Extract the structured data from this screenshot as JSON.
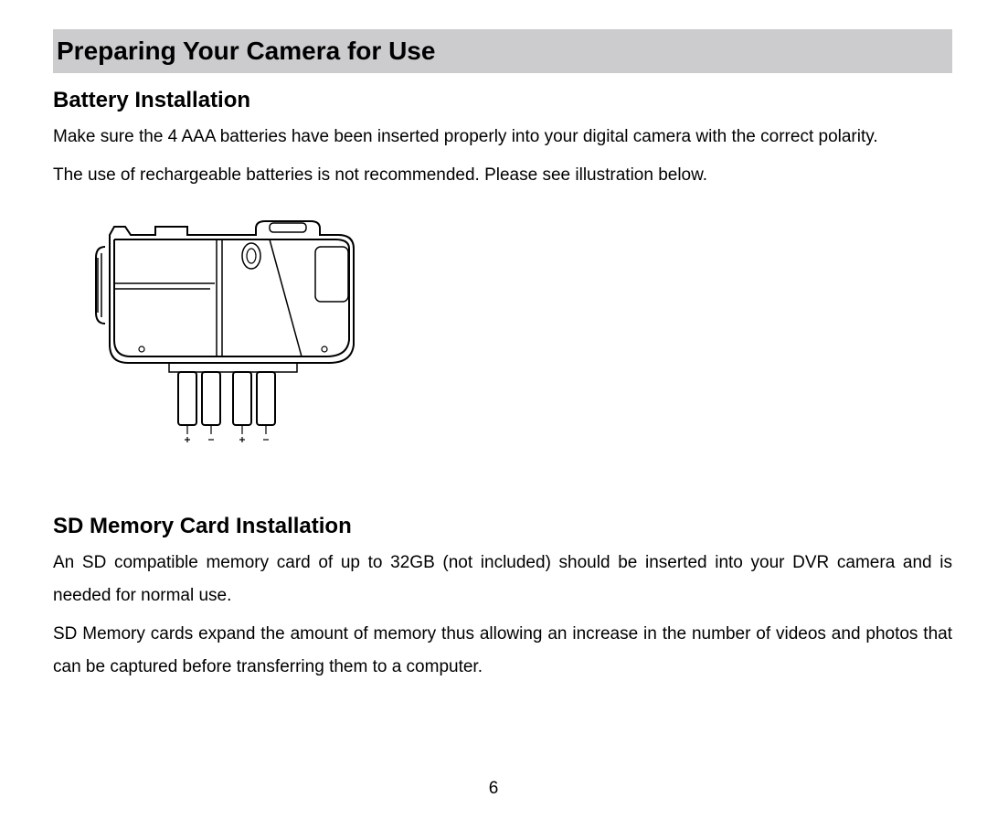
{
  "section_title": "Preparing Your Camera for Use",
  "battery": {
    "heading": "Battery Installation",
    "para1": "Make sure the 4 AAA batteries have been inserted properly into your digital camera with the correct polarity.",
    "para2": "The use of rechargeable batteries is not recommended. Please see illustration below."
  },
  "sd": {
    "heading": "SD Memory Card Installation",
    "para1": "An SD compatible memory card of up to 32GB (not included) should be inserted into your DVR camera and is needed for normal use.",
    "para2": "SD Memory cards expand the amount of memory thus allowing an increase in the number of videos and photos that can be captured before transferring them to a computer."
  },
  "page_number": "6"
}
